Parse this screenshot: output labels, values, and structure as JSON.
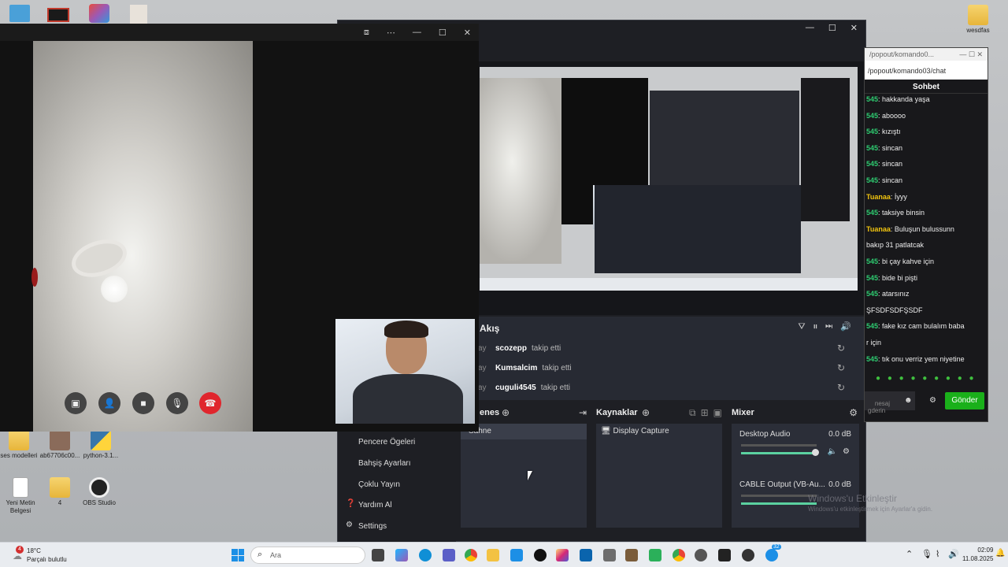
{
  "desktop": {
    "icons": [
      {
        "label": "wesdfas"
      },
      {
        "label": "ses modelleri"
      },
      {
        "label": "ab67706c00..."
      },
      {
        "label": "python-3.1..."
      },
      {
        "label": "Yeni Metin Belgesi"
      },
      {
        "label": "4"
      },
      {
        "label": "OBS Studio"
      }
    ]
  },
  "call": {
    "controls": [
      "screen-share",
      "add-person",
      "camera",
      "microphone",
      "end-call"
    ]
  },
  "obs": {
    "activity": {
      "title": "Akış",
      "rows": [
        {
          "prefix": "ay",
          "user": "scozepp",
          "action": "takip etti"
        },
        {
          "prefix": "ay",
          "user": "Kumsalcim",
          "action": "takip etti"
        },
        {
          "prefix": "ay",
          "user": "cuguli4545",
          "action": "takip etti"
        }
      ]
    },
    "scenes": {
      "title": "enes",
      "item": "Sahne"
    },
    "sources": {
      "title": "Kaynaklar",
      "item": "Display Capture"
    },
    "mixer": {
      "title": "Mixer",
      "channels": [
        {
          "name": "Desktop Audio",
          "level": "0.0 dB"
        },
        {
          "name": "CABLE Output (VB-Au...",
          "level": "0.0 dB"
        }
      ]
    },
    "menu": [
      "Pencere Ögeleri",
      "Bahşiş Ayarları",
      "Çoklu Yayın",
      "Yardım Al",
      "Settings"
    ]
  },
  "chat": {
    "url_top": "/popout/komando0...",
    "url": "/popout/komando03/chat",
    "title": "Sohbet",
    "messages": [
      {
        "name": "545",
        "text": ": hakkanda yaşa",
        "color": "#2ecc71"
      },
      {
        "name": "545",
        "text": ": aboooo",
        "color": "#2ecc71"
      },
      {
        "name": "545",
        "text": ": kızıştı",
        "color": "#2ecc71"
      },
      {
        "name": "545",
        "text": ": sincan",
        "color": "#2ecc71"
      },
      {
        "name": "545",
        "text": ": sincan",
        "color": "#2ecc71"
      },
      {
        "name": "545",
        "text": ": sincan",
        "color": "#2ecc71"
      },
      {
        "name": "Tuanaa",
        "text": ": İyyy",
        "color": "#f1c40f"
      },
      {
        "name": "545",
        "text": ": taksiye binsin",
        "color": "#2ecc71"
      },
      {
        "name": "Tuanaa",
        "text": ": Buluşun bulussunn",
        "color": "#f1c40f"
      },
      {
        "name": "",
        "text": "bakıp 31 patlatcak",
        "color": "#eee"
      },
      {
        "name": "545",
        "text": ": bi çay kahve için",
        "color": "#2ecc71"
      },
      {
        "name": "545",
        "text": ": bide bi pişti",
        "color": "#2ecc71"
      },
      {
        "name": "545",
        "text": ": atarsınız",
        "color": "#2ecc71"
      },
      {
        "name": "",
        "text": "ŞFSDFSDFŞSDF",
        "color": "#eee"
      },
      {
        "name": "545",
        "text": ": fake kız cam bulalım baba",
        "color": "#2ecc71"
      },
      {
        "name": "",
        "text": "r için",
        "color": "#eee"
      },
      {
        "name": "545",
        "text": ": tık onu verriz yem niyetine",
        "color": "#2ecc71"
      }
    ],
    "input_placeholder": "nesaj\ngderin",
    "send_label": "Gönder"
  },
  "watermark": {
    "title": "Windows'u Etkinleştir",
    "subtitle": "Windows'u etkinleştirmek için Ayarlar'a gidin."
  },
  "taskbar": {
    "weather_temp": "18°C",
    "weather_desc": "Parçalı bulutlu",
    "weather_badge": "4",
    "search_placeholder": "Ara",
    "time": "02:09",
    "date": "11.08.2025",
    "notif_badge": "32"
  }
}
